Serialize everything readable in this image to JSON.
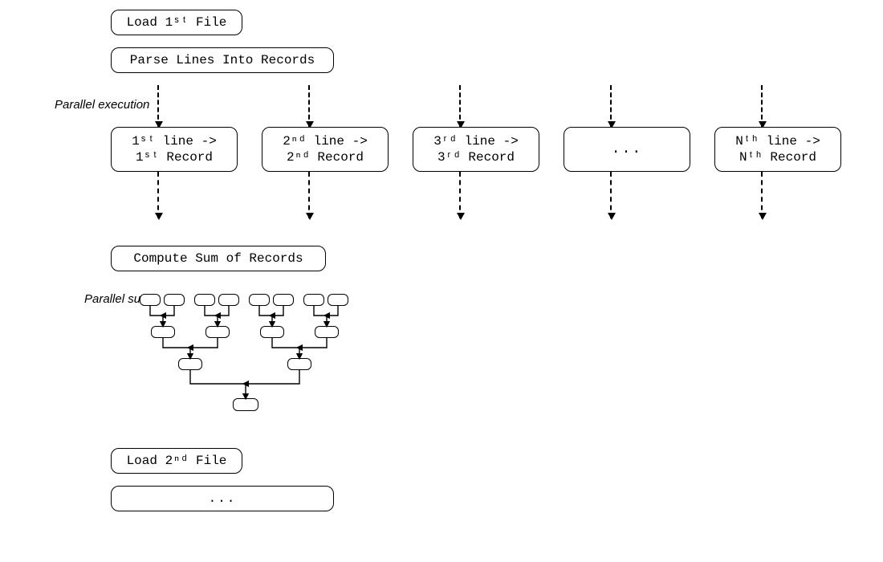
{
  "steps": {
    "load1": "Load 1ˢᵗ File",
    "parse": "Parse Lines Into Records",
    "compute": "Compute Sum of Records",
    "load2": "Load 2ⁿᵈ File",
    "ellipsis": "..."
  },
  "captions": {
    "parallel_exec": "Parallel execution",
    "parallel_sum": "Parallel sum"
  },
  "lanes": [
    {
      "line_ord": "1ˢᵗ",
      "record_ord": "1ˢᵗ"
    },
    {
      "line_ord": "2ⁿᵈ",
      "record_ord": "2ⁿᵈ"
    },
    {
      "line_ord": "3ʳᵈ",
      "record_ord": "3ʳᵈ"
    },
    {
      "ellipsis": "..."
    },
    {
      "line_ord": "Nᵗʰ",
      "record_ord": "Nᵗʰ"
    }
  ],
  "lane_template": {
    "row1_prefix": "",
    "row1_suffix": " line ->",
    "row2_prefix": "",
    "row2_suffix": " Record"
  }
}
